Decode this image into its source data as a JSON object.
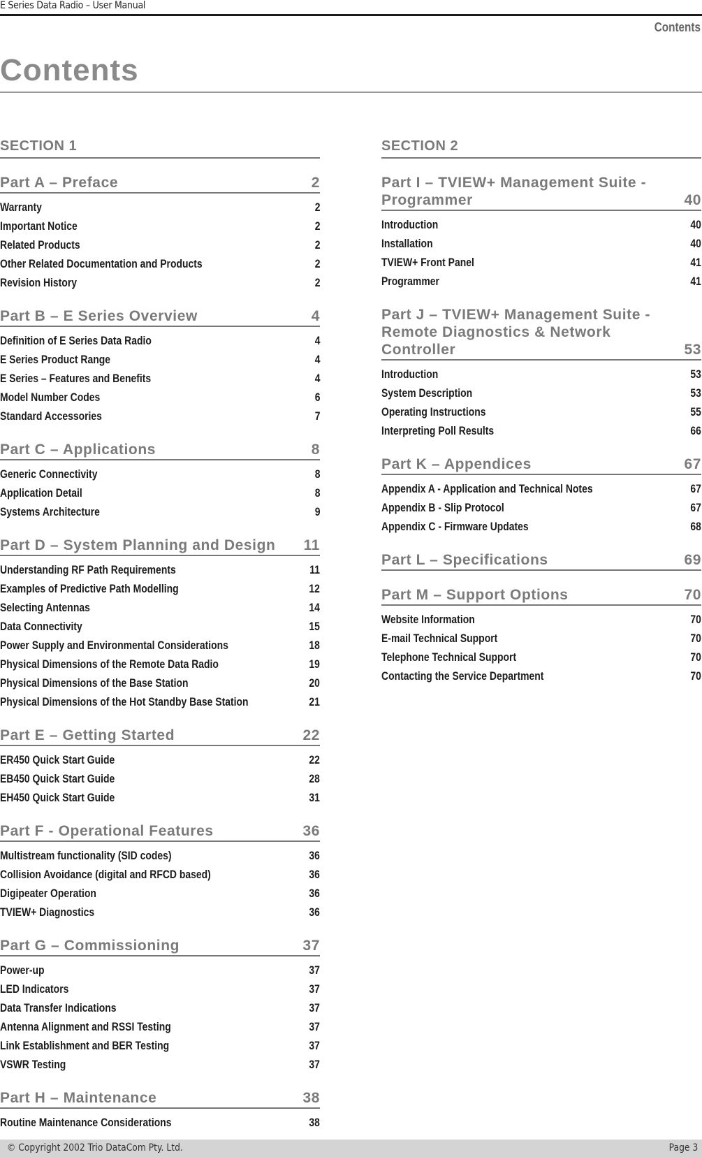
{
  "header": {
    "running_title": "E Series Data Radio – User Manual",
    "section_label": "Contents"
  },
  "page_title": "Contents",
  "section1": {
    "title": "SECTION 1",
    "parts": [
      {
        "title": "Part A – Preface",
        "page": "2",
        "items": [
          {
            "label": "Warranty",
            "page": "2"
          },
          {
            "label": "Important Notice",
            "page": "2"
          },
          {
            "label": "Related Products",
            "page": "2"
          },
          {
            "label": "Other Related Documentation and Products",
            "page": "2"
          },
          {
            "label": "Revision History",
            "page": "2"
          }
        ]
      },
      {
        "title": "Part B – E Series Overview",
        "page": "4",
        "items": [
          {
            "label": "Definition of E Series Data Radio",
            "page": "4"
          },
          {
            "label": "E Series Product Range",
            "page": "4"
          },
          {
            "label": "E Series – Features and Benefits",
            "page": "4"
          },
          {
            "label": "Model Number Codes",
            "page": "6"
          },
          {
            "label": "Standard Accessories",
            "page": "7"
          }
        ]
      },
      {
        "title": "Part C – Applications",
        "page": "8",
        "items": [
          {
            "label": "Generic Connectivity",
            "page": "8"
          },
          {
            "label": "Application Detail",
            "page": "8"
          },
          {
            "label": "Systems Architecture",
            "page": "9"
          }
        ]
      },
      {
        "title": "Part D – System Planning and Design",
        "page": "11",
        "items": [
          {
            "label": "Understanding RF Path Requirements",
            "page": "11"
          },
          {
            "label": "Examples of Predictive Path Modelling",
            "page": "12"
          },
          {
            "label": "Selecting Antennas",
            "page": "14"
          },
          {
            "label": "Data Connectivity",
            "page": "15"
          },
          {
            "label": "Power Supply and Environmental Considerations",
            "page": "18"
          },
          {
            "label": "Physical Dimensions of the Remote Data Radio",
            "page": "19"
          },
          {
            "label": "Physical Dimensions of the Base Station",
            "page": "20"
          },
          {
            "label": "Physical Dimensions of the Hot Standby Base Station",
            "page": "21"
          }
        ]
      },
      {
        "title": "Part E – Getting Started",
        "page": "22",
        "items": [
          {
            "label": "ER450 Quick Start Guide",
            "page": "22"
          },
          {
            "label": "EB450 Quick Start Guide",
            "page": "28"
          },
          {
            "label": "EH450 Quick Start Guide",
            "page": "31"
          }
        ]
      },
      {
        "title": "Part F - Operational Features",
        "page": "36",
        "items": [
          {
            "label": "Multistream functionality (SID codes)",
            "page": "36"
          },
          {
            "label": "Collision Avoidance (digital and RFCD based)",
            "page": "36"
          },
          {
            "label": "Digipeater Operation",
            "page": "36"
          },
          {
            "label": "TVIEW+ Diagnostics",
            "page": "36"
          }
        ]
      },
      {
        "title": "Part G – Commissioning",
        "page": "37",
        "items": [
          {
            "label": "Power-up",
            "page": "37"
          },
          {
            "label": "LED Indicators",
            "page": "37"
          },
          {
            "label": "Data Transfer Indications",
            "page": "37"
          },
          {
            "label": "Antenna Alignment and RSSI Testing",
            "page": "37"
          },
          {
            "label": "Link Establishment and BER Testing",
            "page": "37"
          },
          {
            "label": "VSWR Testing",
            "page": "37"
          }
        ]
      },
      {
        "title": "Part H – Maintenance",
        "page": "38",
        "items": [
          {
            "label": "Routine Maintenance Considerations",
            "page": "38"
          }
        ]
      }
    ]
  },
  "section2": {
    "title": "SECTION 2",
    "parts": [
      {
        "title": "Part I – TVIEW+ Management Suite -\nProgrammer",
        "page": "40",
        "items": [
          {
            "label": "Introduction",
            "page": "40"
          },
          {
            "label": "Installation",
            "page": "40"
          },
          {
            "label": "TVIEW+ Front Panel",
            "page": "41"
          },
          {
            "label": "Programmer",
            "page": "41"
          }
        ]
      },
      {
        "title": "Part J – TVIEW+ Management Suite -\nRemote Diagnostics & Network\nController",
        "page": "53",
        "items": [
          {
            "label": "Introduction",
            "page": "53"
          },
          {
            "label": "System Description",
            "page": "53"
          },
          {
            "label": "Operating Instructions",
            "page": "55"
          },
          {
            "label": "Interpreting Poll Results",
            "page": "66"
          }
        ]
      },
      {
        "title": "Part K – Appendices",
        "page": "67",
        "items": [
          {
            "label": "Appendix A - Application and Technical Notes",
            "page": "67"
          },
          {
            "label": "Appendix B - Slip Protocol",
            "page": "67"
          },
          {
            "label": "Appendix C - Firmware Updates",
            "page": "68"
          }
        ]
      },
      {
        "title": "Part L – Specifications",
        "page": "69",
        "items": []
      },
      {
        "title": "Part M – Support Options",
        "page": "70",
        "items": [
          {
            "label": "Website Information",
            "page": "70"
          },
          {
            "label": "E-mail Technical Support",
            "page": "70"
          },
          {
            "label": "Telephone Technical Support",
            "page": "70"
          },
          {
            "label": "Contacting the Service Department",
            "page": "70"
          }
        ]
      }
    ]
  },
  "footer": {
    "copyright": "© Copyright 2002 Trio DataCom Pty. Ltd.",
    "page_label": "Page 3"
  }
}
